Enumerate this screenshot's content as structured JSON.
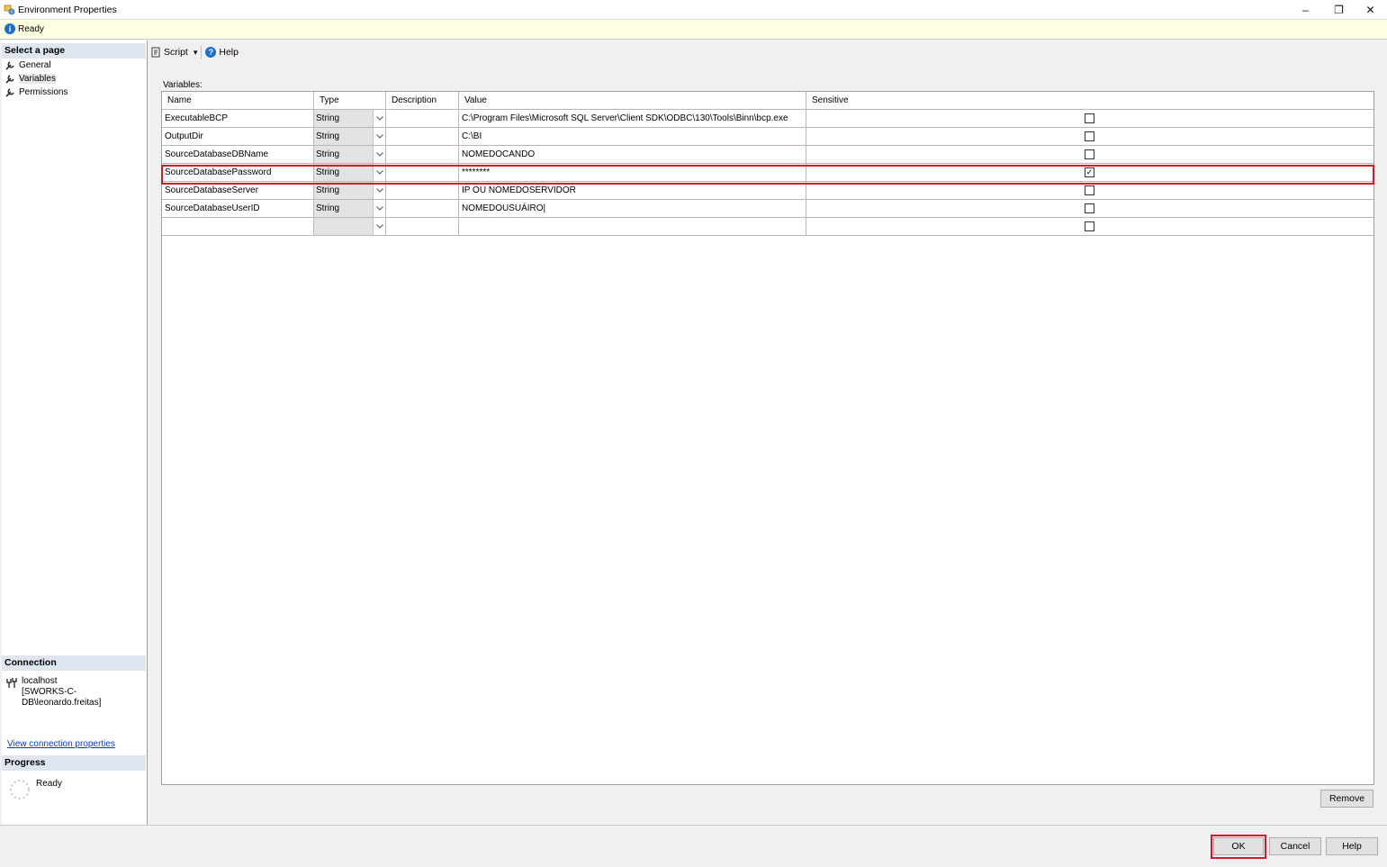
{
  "window": {
    "title": "Environment Properties",
    "icon": "environment-icon",
    "controls": [
      "–",
      "❐",
      "✕"
    ]
  },
  "status": {
    "text": "Ready",
    "icon": "info-icon"
  },
  "sidebar": {
    "select_page_label": "Select a page",
    "pages": [
      {
        "label": "General",
        "icon": "wrench-icon"
      },
      {
        "label": "Variables",
        "icon": "wrench-icon",
        "selected": true
      },
      {
        "label": "Permissions",
        "icon": "wrench-icon"
      }
    ],
    "connection": {
      "header": "Connection",
      "host": "localhost",
      "user": "[SWORKS-C-DB\\leonardo.freitas]",
      "link": "View connection properties"
    },
    "progress": {
      "header": "Progress",
      "status": "Ready"
    }
  },
  "toolbar": {
    "script_label": "Script",
    "script_arrow": "▾",
    "help_label": "Help"
  },
  "variables": {
    "label": "Variables:",
    "columns": [
      "Name",
      "Type",
      "Description",
      "Value",
      "Sensitive"
    ],
    "rows": [
      {
        "name": "ExecutableBCP",
        "type": "String",
        "description": "",
        "value": "C:\\Program Files\\Microsoft SQL Server\\Client SDK\\ODBC\\130\\Tools\\Binn\\bcp.exe",
        "sensitive": false
      },
      {
        "name": "OutputDir",
        "type": "String",
        "description": "",
        "value": "C:\\BI",
        "sensitive": false
      },
      {
        "name": "SourceDatabaseDBName",
        "type": "String",
        "description": "",
        "value": "NOMEDOCANDO",
        "sensitive": false
      },
      {
        "name": "SourceDatabasePassword",
        "type": "String",
        "description": "",
        "value": "********",
        "sensitive": true
      },
      {
        "name": "SourceDatabaseServer",
        "type": "String",
        "description": "",
        "value": "IP OU NOMEDOSERVIDOR",
        "sensitive": false
      },
      {
        "name": "SourceDatabaseUserID",
        "type": "String",
        "description": "",
        "value": "NOMEDOUSUÁIRO|",
        "sensitive": false
      },
      {
        "name": "",
        "type": "",
        "description": "",
        "value": "",
        "sensitive": false
      }
    ]
  },
  "buttons": {
    "remove": "Remove",
    "ok": "OK",
    "cancel": "Cancel",
    "help": "Help"
  },
  "colors": {
    "highlight": "#d11a2a",
    "status_bg": "#ffffe1",
    "section_bg": "#dfe6ef",
    "link": "#0044cc"
  }
}
